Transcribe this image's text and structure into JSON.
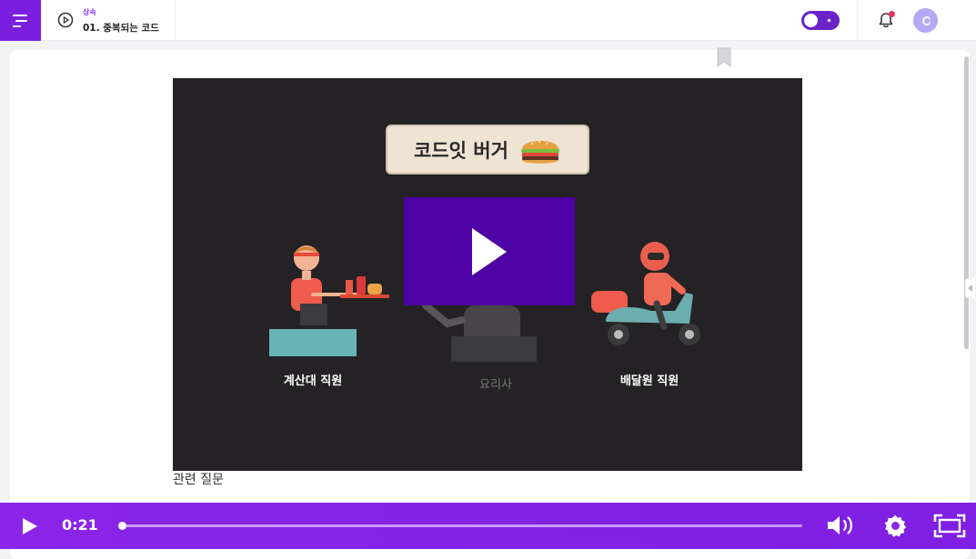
{
  "header": {
    "section": "상속",
    "lesson_title": "01. 중복되는 코드",
    "notification_count": "1",
    "avatar_initial": "C"
  },
  "video": {
    "banner_title": "코드잇 버거",
    "roles": [
      {
        "label": "계산대 직원"
      },
      {
        "label": "요리사"
      },
      {
        "label": "배달원 직원"
      }
    ]
  },
  "related_questions_label": "관련 질문",
  "player": {
    "current_time": "0:21",
    "progress": 0.003
  },
  "colors": {
    "brand_purple": "#7a1fe0",
    "play_overlay": "#5000aa",
    "controls_bar": "#8a25e8"
  },
  "icons": [
    "menu-icon",
    "lesson-play-icon",
    "dark-mode-toggle",
    "bell-icon",
    "avatar",
    "bookmark-icon",
    "play-icon",
    "volume-icon",
    "settings-icon",
    "fullscreen-icon"
  ]
}
